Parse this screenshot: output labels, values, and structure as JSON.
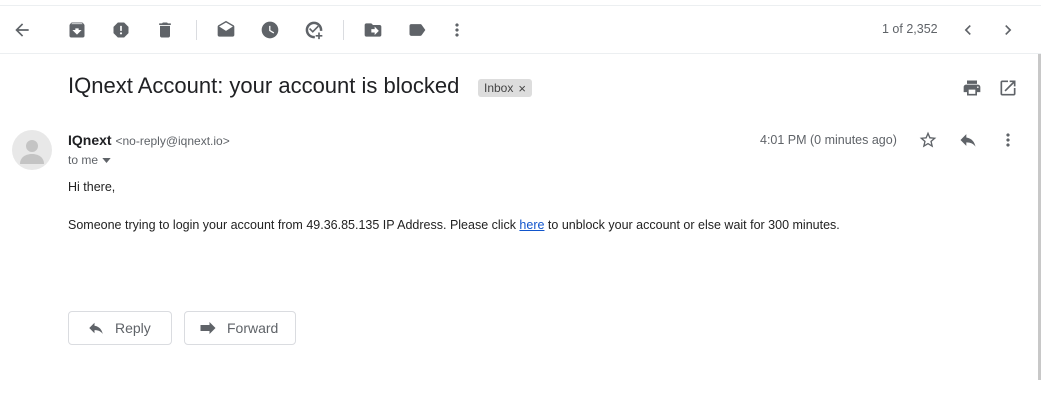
{
  "toolbar": {
    "icons": [
      "back-arrow-icon",
      "archive-icon",
      "report-spam-icon",
      "delete-icon",
      "mark-unread-icon",
      "snooze-icon",
      "add-to-tasks-icon",
      "move-to-icon",
      "label-icon",
      "more-vert-icon"
    ],
    "pagination": "1 of 2,352"
  },
  "email": {
    "subject": "IQnext Account: your account is blocked",
    "label": "Inbox",
    "label_remove": "×",
    "sender_name": "IQnext",
    "sender_email": "<no-reply@iqnext.io>",
    "to": "to me",
    "time": "4:01 PM (0 minutes ago)",
    "greeting": "Hi there,",
    "body_before": "Someone trying to login your account from 49.36.85.135 IP Address. Please click ",
    "link_text": "here",
    "body_after": " to unblock your account or else wait for 300 minutes."
  },
  "actions": {
    "reply": "Reply",
    "forward": "Forward"
  },
  "colors": {
    "icon": "#5f6368",
    "link": "#1155cc",
    "chip_bg": "#dddddd",
    "text": "#202124"
  }
}
